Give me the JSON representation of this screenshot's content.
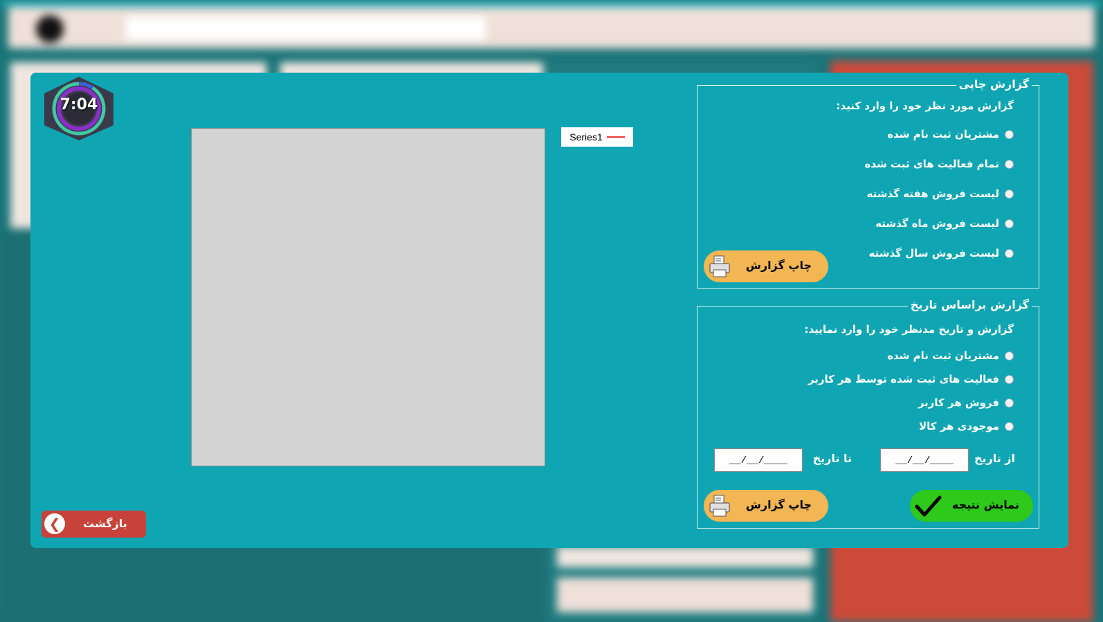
{
  "timer": {
    "time": "7:04"
  },
  "chart_data": {
    "type": "line",
    "series": [
      {
        "name": "Series1",
        "values": []
      }
    ],
    "legend": "top-right"
  },
  "legend": {
    "series_label": "Series1",
    "series_color": "#e53935"
  },
  "back_button": {
    "label": "بازگشت"
  },
  "print_report": {
    "title": "گزارش چاپی",
    "prompt": "گزارش مورد نظر خود را وارد کنید:",
    "options": [
      "مشتریان ثبت نام شده",
      "تمام فعالیت های ثبت شده",
      "لیست فروش هفته گذشته",
      "لیست فروش ماه گذشته",
      "لیست فروش سال گذشته"
    ],
    "print_label": "چاپ گزارش"
  },
  "date_report": {
    "title": "گزارش براساس تاریخ",
    "prompt": "گزارش و تاریخ مدنظر خود را وارد نمایید:",
    "options": [
      "مشتریان ثبت نام شده",
      "فعالیت های ثبت شده توسط هر کاربر",
      "فروش هر کاربر",
      "موجودی هر کالا"
    ],
    "from_label": "از تاریخ",
    "to_label": "تا تاریخ",
    "from_value": "__/__/____",
    "to_value": "__/__/____",
    "show_label": "نمایش نتیجه",
    "print_label": "چاپ گزارش"
  },
  "colors": {
    "dialog": "#10a5b2",
    "print_button": "#f2b654",
    "show_button": "#2ec91a",
    "back_button": "#c8423a"
  }
}
